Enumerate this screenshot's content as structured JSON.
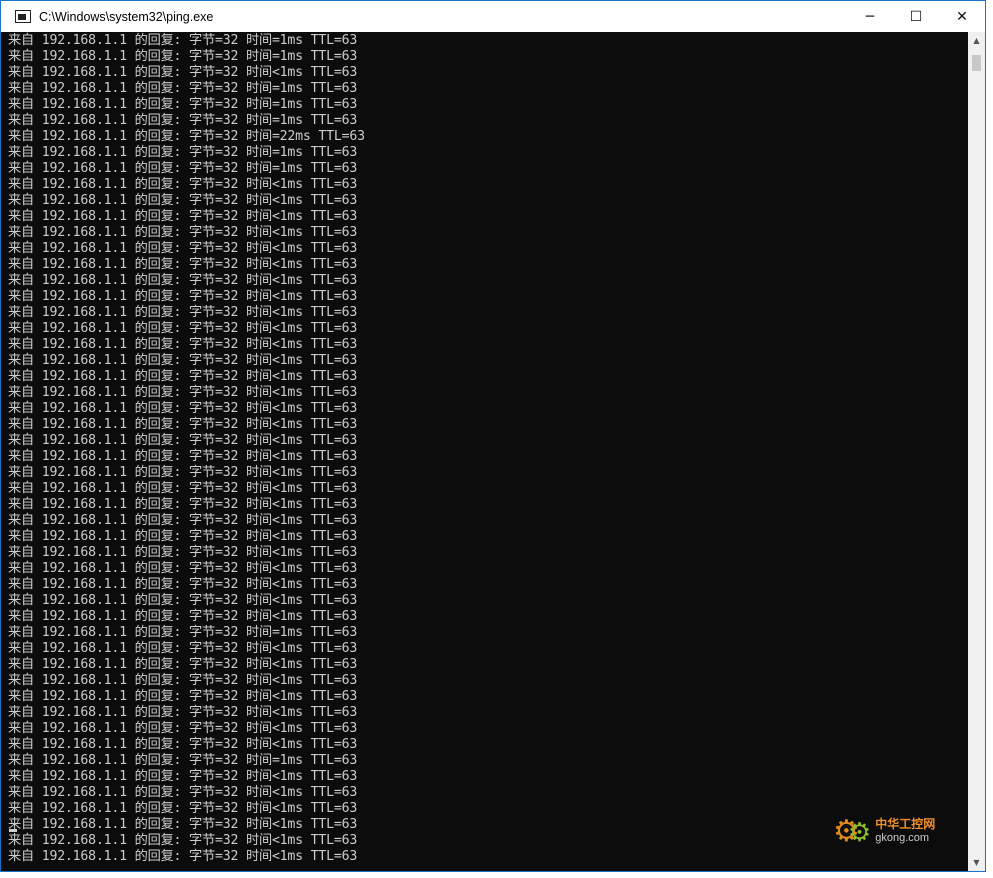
{
  "window": {
    "title": "C:\\Windows\\system32\\ping.exe",
    "controls": {
      "minimize": "─",
      "maximize": "☐",
      "close": "✕"
    }
  },
  "console": {
    "lines": [
      "来自 192.168.1.1 的回复: 字节=32 时间=1ms TTL=63",
      "来自 192.168.1.1 的回复: 字节=32 时间=1ms TTL=63",
      "来自 192.168.1.1 的回复: 字节=32 时间<1ms TTL=63",
      "来自 192.168.1.1 的回复: 字节=32 时间=1ms TTL=63",
      "来自 192.168.1.1 的回复: 字节=32 时间=1ms TTL=63",
      "来自 192.168.1.1 的回复: 字节=32 时间=1ms TTL=63",
      "来自 192.168.1.1 的回复: 字节=32 时间=22ms TTL=63",
      "来自 192.168.1.1 的回复: 字节=32 时间=1ms TTL=63",
      "来自 192.168.1.1 的回复: 字节=32 时间=1ms TTL=63",
      "来自 192.168.1.1 的回复: 字节=32 时间<1ms TTL=63",
      "来自 192.168.1.1 的回复: 字节=32 时间<1ms TTL=63",
      "来自 192.168.1.1 的回复: 字节=32 时间<1ms TTL=63",
      "来自 192.168.1.1 的回复: 字节=32 时间<1ms TTL=63",
      "来自 192.168.1.1 的回复: 字节=32 时间<1ms TTL=63",
      "来自 192.168.1.1 的回复: 字节=32 时间<1ms TTL=63",
      "来自 192.168.1.1 的回复: 字节=32 时间<1ms TTL=63",
      "来自 192.168.1.1 的回复: 字节=32 时间<1ms TTL=63",
      "来自 192.168.1.1 的回复: 字节=32 时间<1ms TTL=63",
      "来自 192.168.1.1 的回复: 字节=32 时间<1ms TTL=63",
      "来自 192.168.1.1 的回复: 字节=32 时间<1ms TTL=63",
      "来自 192.168.1.1 的回复: 字节=32 时间<1ms TTL=63",
      "来自 192.168.1.1 的回复: 字节=32 时间<1ms TTL=63",
      "来自 192.168.1.1 的回复: 字节=32 时间<1ms TTL=63",
      "来自 192.168.1.1 的回复: 字节=32 时间<1ms TTL=63",
      "来自 192.168.1.1 的回复: 字节=32 时间<1ms TTL=63",
      "来自 192.168.1.1 的回复: 字节=32 时间<1ms TTL=63",
      "来自 192.168.1.1 的回复: 字节=32 时间<1ms TTL=63",
      "来自 192.168.1.1 的回复: 字节=32 时间<1ms TTL=63",
      "来自 192.168.1.1 的回复: 字节=32 时间<1ms TTL=63",
      "来自 192.168.1.1 的回复: 字节=32 时间<1ms TTL=63",
      "来自 192.168.1.1 的回复: 字节=32 时间<1ms TTL=63",
      "来自 192.168.1.1 的回复: 字节=32 时间<1ms TTL=63",
      "来自 192.168.1.1 的回复: 字节=32 时间<1ms TTL=63",
      "来自 192.168.1.1 的回复: 字节=32 时间<1ms TTL=63",
      "来自 192.168.1.1 的回复: 字节=32 时间<1ms TTL=63",
      "来自 192.168.1.1 的回复: 字节=32 时间<1ms TTL=63",
      "来自 192.168.1.1 的回复: 字节=32 时间<1ms TTL=63",
      "来自 192.168.1.1 的回复: 字节=32 时间=1ms TTL=63",
      "来自 192.168.1.1 的回复: 字节=32 时间<1ms TTL=63",
      "来自 192.168.1.1 的回复: 字节=32 时间<1ms TTL=63",
      "来自 192.168.1.1 的回复: 字节=32 时间<1ms TTL=63",
      "来自 192.168.1.1 的回复: 字节=32 时间<1ms TTL=63",
      "来自 192.168.1.1 的回复: 字节=32 时间<1ms TTL=63",
      "来自 192.168.1.1 的回复: 字节=32 时间<1ms TTL=63",
      "来自 192.168.1.1 的回复: 字节=32 时间<1ms TTL=63",
      "来自 192.168.1.1 的回复: 字节=32 时间=1ms TTL=63",
      "来自 192.168.1.1 的回复: 字节=32 时间<1ms TTL=63",
      "来自 192.168.1.1 的回复: 字节=32 时间<1ms TTL=63",
      "来自 192.168.1.1 的回复: 字节=32 时间<1ms TTL=63",
      "来自 192.168.1.1 的回复: 字节=32 时间<1ms TTL=63",
      "来自 192.168.1.1 的回复: 字节=32 时间<1ms TTL=63",
      "来自 192.168.1.1 的回复: 字节=32 时间<1ms TTL=63"
    ]
  },
  "watermark": {
    "top": "中华工控网",
    "bottom": "gkong.com"
  },
  "colors": {
    "console_bg": "#0c0c0c",
    "console_text": "#cccccc",
    "title_bg": "#ffffff",
    "border": "#1a73c7"
  }
}
